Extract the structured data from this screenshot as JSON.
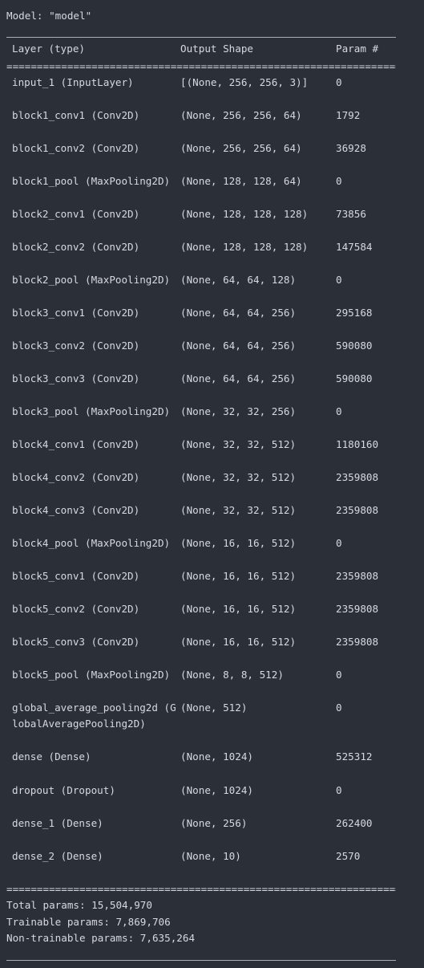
{
  "model_title": "Model: \"model\"",
  "headers": {
    "layer": "Layer (type)",
    "shape": "Output Shape",
    "param": "Param #"
  },
  "separator_text": "====================================================================================",
  "rows": [
    {
      "layer": "input_1 (InputLayer)",
      "shape": "[(None, 256, 256, 3)]",
      "param": "0"
    },
    {
      "layer": "block1_conv1 (Conv2D)",
      "shape": "(None, 256, 256, 64)",
      "param": "1792"
    },
    {
      "layer": "block1_conv2 (Conv2D)",
      "shape": "(None, 256, 256, 64)",
      "param": "36928"
    },
    {
      "layer": "block1_pool (MaxPooling2D)",
      "shape": "(None, 128, 128, 64)",
      "param": "0"
    },
    {
      "layer": "block2_conv1 (Conv2D)",
      "shape": "(None, 128, 128, 128)",
      "param": "73856"
    },
    {
      "layer": "block2_conv2 (Conv2D)",
      "shape": "(None, 128, 128, 128)",
      "param": "147584"
    },
    {
      "layer": "block2_pool (MaxPooling2D)",
      "shape": "(None, 64, 64, 128)",
      "param": "0"
    },
    {
      "layer": "block3_conv1 (Conv2D)",
      "shape": "(None, 64, 64, 256)",
      "param": "295168"
    },
    {
      "layer": "block3_conv2 (Conv2D)",
      "shape": "(None, 64, 64, 256)",
      "param": "590080"
    },
    {
      "layer": "block3_conv3 (Conv2D)",
      "shape": "(None, 64, 64, 256)",
      "param": "590080"
    },
    {
      "layer": "block3_pool (MaxPooling2D)",
      "shape": "(None, 32, 32, 256)",
      "param": "0"
    },
    {
      "layer": "block4_conv1 (Conv2D)",
      "shape": "(None, 32, 32, 512)",
      "param": "1180160"
    },
    {
      "layer": "block4_conv2 (Conv2D)",
      "shape": "(None, 32, 32, 512)",
      "param": "2359808"
    },
    {
      "layer": "block4_conv3 (Conv2D)",
      "shape": "(None, 32, 32, 512)",
      "param": "2359808"
    },
    {
      "layer": "block4_pool (MaxPooling2D)",
      "shape": "(None, 16, 16, 512)",
      "param": "0"
    },
    {
      "layer": "block5_conv1 (Conv2D)",
      "shape": "(None, 16, 16, 512)",
      "param": "2359808"
    },
    {
      "layer": "block5_conv2 (Conv2D)",
      "shape": "(None, 16, 16, 512)",
      "param": "2359808"
    },
    {
      "layer": "block5_conv3 (Conv2D)",
      "shape": "(None, 16, 16, 512)",
      "param": "2359808"
    },
    {
      "layer": "block5_pool (MaxPooling2D)",
      "shape": "(None, 8, 8, 512)",
      "param": "0"
    },
    {
      "layer": "global_average_pooling2d (G\nlobalAveragePooling2D)",
      "shape": "(None, 512)",
      "param": "0"
    },
    {
      "layer": "dense (Dense)",
      "shape": "(None, 1024)",
      "param": "525312"
    },
    {
      "layer": "dropout (Dropout)",
      "shape": "(None, 1024)",
      "param": "0"
    },
    {
      "layer": "dense_1 (Dense)",
      "shape": "(None, 256)",
      "param": "262400"
    },
    {
      "layer": "dense_2 (Dense)",
      "shape": "(None, 10)",
      "param": "2570"
    }
  ],
  "totals": {
    "total": "Total params: 15,504,970",
    "trainable": "Trainable params: 7,869,706",
    "non_trainable": "Non-trainable params: 7,635,264"
  },
  "colors": {
    "background": "#2b2f38",
    "text": "#d6d9de"
  }
}
